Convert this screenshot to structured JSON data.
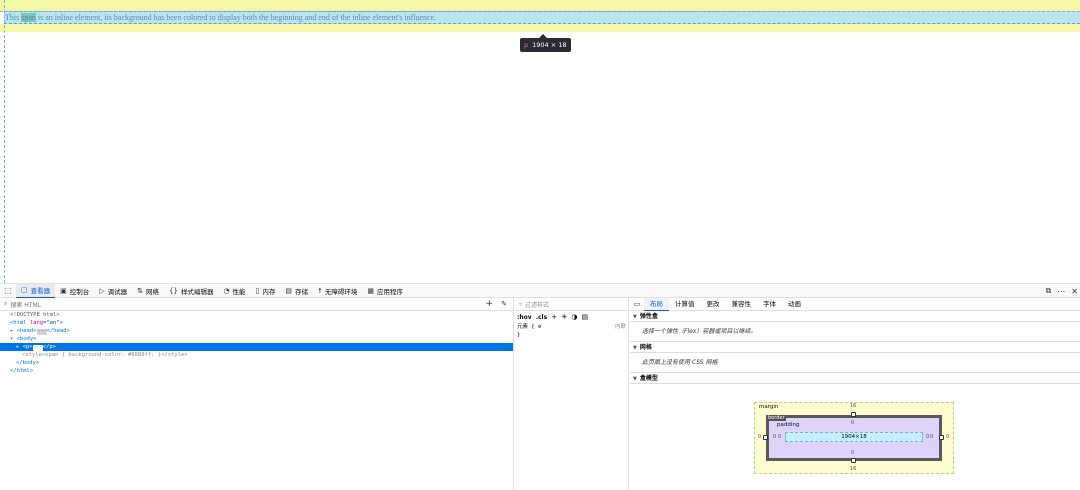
{
  "preview": {
    "text_before": "This ",
    "span_text": "span",
    "text_after": " is an inline element, its background has been colored to display both the beginning and end of the inline element's influence.",
    "tooltip_tag": "p",
    "tooltip_size": "1904 × 18"
  },
  "toolbar": {
    "tabs": [
      {
        "label": "查看器",
        "icon": "inspector-icon"
      },
      {
        "label": "控制台",
        "icon": "console-icon"
      },
      {
        "label": "调试器",
        "icon": "debugger-icon"
      },
      {
        "label": "网络",
        "icon": "network-icon"
      },
      {
        "label": "样式编辑器",
        "icon": "style-editor-icon"
      },
      {
        "label": "性能",
        "icon": "performance-icon"
      },
      {
        "label": "内存",
        "icon": "memory-icon"
      },
      {
        "label": "存储",
        "icon": "storage-icon"
      },
      {
        "label": "无障碍环境",
        "icon": "accessibility-icon"
      },
      {
        "label": "应用程序",
        "icon": "application-icon"
      }
    ]
  },
  "markup": {
    "search_placeholder": "搜索 HTML",
    "lines": {
      "doctype": "<!DOCTYPE html>",
      "html_open_tag": "<html",
      "html_attr": " lang",
      "html_attr_val": "=\"en\">",
      "head": "<head>",
      "head_badge": "···",
      "head_close": "</head>",
      "body_open": "<body>",
      "p_open": "<p>",
      "p_badge": "···",
      "p_close": "</p>",
      "style_line": "<style>span { background-color: #8888ff; }</style>",
      "body_close": "</body>",
      "html_close": "</html>"
    }
  },
  "rules": {
    "filter_placeholder": "过滤样式",
    "hov": ":hov",
    "cls": ".cls",
    "element_rule": "元素 {",
    "element_rule_close": "}",
    "source": "内联"
  },
  "layout_panel": {
    "tabs": [
      "布局",
      "计算值",
      "更改",
      "兼容性",
      "字体",
      "动画"
    ],
    "sections": {
      "flex_title": "弹性盒",
      "flex_note": "选择一个弹性（Flex）容器或项目以继续。",
      "grid_title": "网格",
      "grid_note": "此页面上没有使用 CSS 网格",
      "boxmodel_title": "盒模型"
    },
    "boxmodel": {
      "margin_label": "margin",
      "border_label": "border",
      "padding_label": "padding",
      "content_size": "1904×18",
      "margin_top": "16",
      "margin_bottom": "16",
      "margin_left": "0",
      "margin_right": "0",
      "border_top": "0",
      "border_bottom": "0",
      "border_left": "0",
      "border_right": "0",
      "padding_top": "0",
      "padding_bottom": "0",
      "padding_left": "0",
      "padding_right": "0"
    }
  }
}
